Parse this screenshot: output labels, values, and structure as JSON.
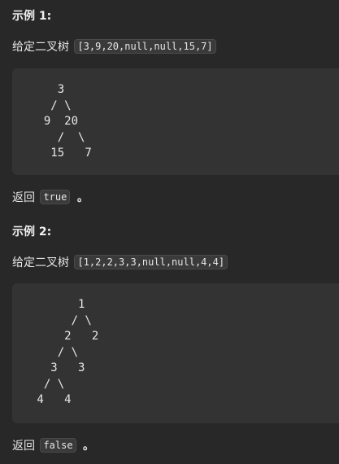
{
  "example1": {
    "heading": "示例 1:",
    "given_label": "给定二叉树",
    "given_value": "[3,9,20,null,null,15,7]",
    "tree_ascii": "    3\n   / \\\n  9  20\n    /  \\\n   15   7",
    "return_label": "返回",
    "return_value": "true",
    "return_suffix": "。"
  },
  "example2": {
    "heading": "示例 2:",
    "given_label": "给定二叉树",
    "given_value": "[1,2,2,3,3,null,null,4,4]",
    "tree_ascii": "       1\n      / \\\n     2   2\n    / \\\n   3   3\n  / \\\n 4   4",
    "return_label": "返回",
    "return_value": "false",
    "return_suffix": "。"
  }
}
